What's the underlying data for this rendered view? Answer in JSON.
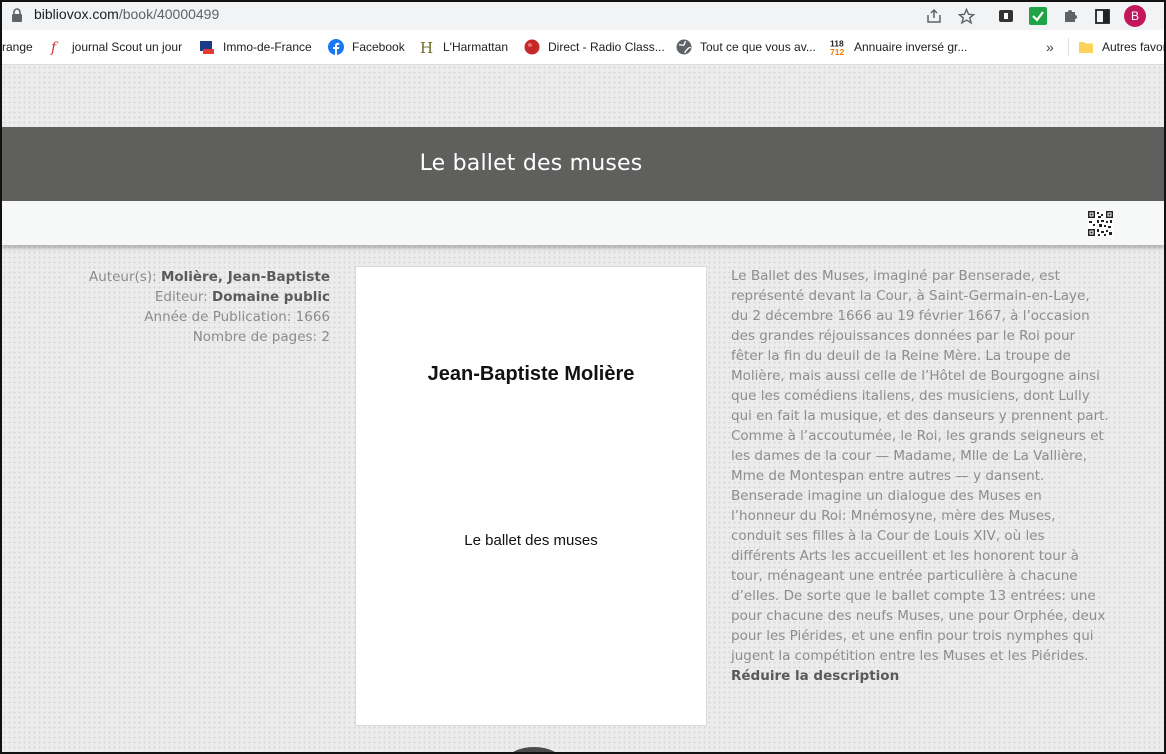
{
  "browser": {
    "url_domain": "bibliovox.com",
    "url_path": "/book/40000499",
    "avatar_letter": "B",
    "more_bookmarks": "»",
    "bookmarks": [
      {
        "label": "range",
        "icon": "none"
      },
      {
        "label": "journal Scout un jour",
        "icon": "red-f-icon"
      },
      {
        "label": "Immo-de-France",
        "icon": "immo-icon"
      },
      {
        "label": "Facebook",
        "icon": "facebook-icon"
      },
      {
        "label": "L'Harmattan",
        "icon": "harmattan-icon"
      },
      {
        "label": "Direct - Radio Class...",
        "icon": "radio-icon"
      },
      {
        "label": "Tout ce que vous av...",
        "icon": "globe-icon"
      },
      {
        "label": "Annuaire inversé gr...",
        "icon": "118-icon"
      },
      {
        "label": "Autres favor",
        "icon": "folder-icon"
      }
    ],
    "icon_118_top": "118",
    "icon_118_bottom": "712",
    "icon_harmattan": "H"
  },
  "book": {
    "title": "Le ballet des muses",
    "meta": {
      "author_label": "Auteur(s):",
      "author_value": "Molière, Jean-Baptiste",
      "publisher_label": "Editeur:",
      "publisher_value": "Domaine public",
      "year_label": "Année de Publication:",
      "year_value": "1666",
      "pages_label": "Nombre de pages:",
      "pages_value": "2"
    },
    "cover": {
      "author": "Jean-Baptiste Molière",
      "title": "Le ballet des muses"
    },
    "description": "Le Ballet des Muses, imaginé par Benserade, est représenté devant la Cour, à Saint-Germain-en-Laye, du 2 décembre 1666 au 19 février 1667, à l’occasion des grandes réjouissances données par le Roi pour fêter la fin du deuil de la Reine Mère. La troupe de Molière, mais aussi celle de l’Hôtel de Bourgogne ainsi que les comédiens italiens, des musiciens, dont Lully qui en fait la musique, et des danseurs y prennent part. Comme à l’accoutumée, le Roi, les grands seigneurs et les dames de la cour — Madame, Mlle de La Vallière, Mme de Montespan entre autres — y dansent. Benserade imagine un dialogue des Muses en l’honneur du Roi: Mnémosyne, mère des Muses, conduit ses filles à la Cour de Louis XIV, où les différents Arts les accueillent et les honorent tour à tour, ménageant une entrée particulière à chacune d’elles. De sorte que le ballet compte 13 entrées: une pour chacune des neufs Muses, une pour Orphée, deux pour les Piérides, et une enfin pour trois nymphes qui jugent la compétition entre les Muses et les Piérides.",
    "description_toggle": "Réduire la description"
  },
  "colors": {
    "title_band": "#5f605e",
    "avatar": "#c2185b",
    "description_text": "#8d8d8d"
  }
}
